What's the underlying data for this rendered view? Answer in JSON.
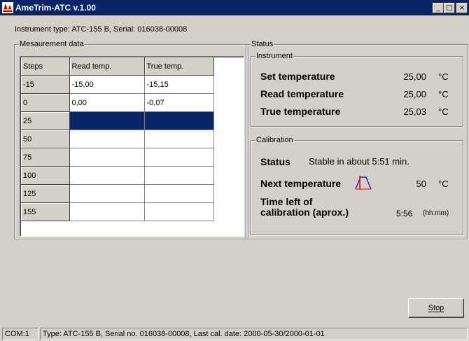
{
  "window": {
    "title": "AmeTrim-ATC v.1.00",
    "minimize_glyph": "_",
    "maximize_glyph": "□",
    "close_glyph": "×",
    "titlebar_color": "#0a246a"
  },
  "instrument_info": "Instrument type:  ATC-155 B, Serial: 016038-00008",
  "measurement": {
    "label": "Mesaurement data",
    "columns": [
      "Steps",
      "Read temp.",
      "True temp."
    ],
    "rows": [
      {
        "step": "-15",
        "read": "-15,00",
        "true": "-15,15"
      },
      {
        "step": "0",
        "read": "0,00",
        "true": "-0,07"
      },
      {
        "step": "25",
        "read": "",
        "true": ""
      },
      {
        "step": "50",
        "read": "",
        "true": ""
      },
      {
        "step": "75",
        "read": "",
        "true": ""
      },
      {
        "step": "100",
        "read": "",
        "true": ""
      },
      {
        "step": "125",
        "read": "",
        "true": ""
      },
      {
        "step": "155",
        "read": "",
        "true": ""
      }
    ],
    "selected_row_color": "#0a246a"
  },
  "status": {
    "label": "Status",
    "instrument": {
      "label": "Instrument",
      "set_label": "Set temperature",
      "set_value": "25,00",
      "read_label": "Read temperature",
      "read_value": "25,00",
      "true_label": "True temperature",
      "true_value": "25,03",
      "unit": "°C"
    },
    "calibration": {
      "label": "Calibration",
      "status_label": "Status",
      "status_value": "Stable in about 5:51 min.",
      "next_label": "Next temperature",
      "next_value": "50",
      "next_unit": "°C",
      "time_label_line1": "Time left of",
      "time_label_line2": "calibration (aprox.)",
      "time_value": "5:56",
      "time_unit": "(hh:mm)"
    }
  },
  "buttons": {
    "stop_label": "Stop"
  },
  "statusbar": {
    "port": "COM:1",
    "info": "Type: ATC-155 B, Serial no. 016038-00008, Last cal. date: 2000-05-30/2000-01-01"
  },
  "icons": {
    "app": "app-icon",
    "next_temperature": "temperature-profile-icon"
  }
}
